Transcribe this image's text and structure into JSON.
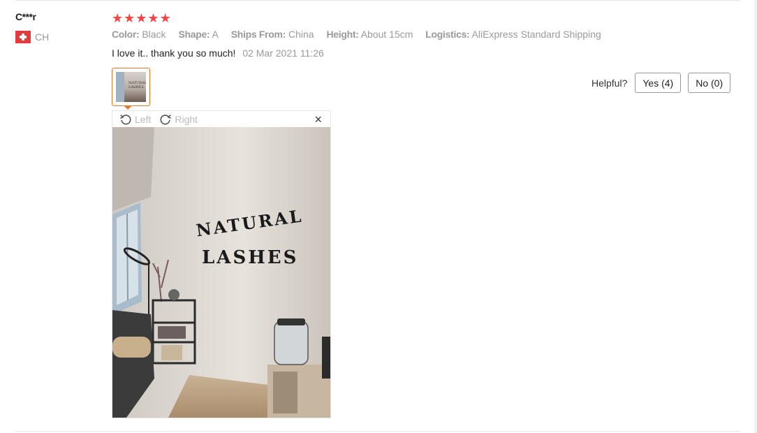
{
  "review": {
    "user": {
      "name": "C***r",
      "country": "CH"
    },
    "rating": 5,
    "attributes": [
      {
        "key": "Color:",
        "value": "Black"
      },
      {
        "key": "Shape:",
        "value": "A"
      },
      {
        "key": "Ships From:",
        "value": "China"
      },
      {
        "key": "Height:",
        "value": "About 15cm"
      },
      {
        "key": "Logistics:",
        "value": "AliExpress Standard Shipping"
      }
    ],
    "text": "I love it.. thank you so much!",
    "date": "02 Mar 2021 11:26",
    "photo_text": {
      "line1": "NATURAL",
      "line2": "LASHES"
    }
  },
  "viewer": {
    "rotate_left_label": "Left",
    "rotate_right_label": "Right",
    "close_glyph": "×"
  },
  "helpful": {
    "label": "Helpful?",
    "yes_label": "Yes (4)",
    "no_label": "No (0)"
  },
  "colors": {
    "star": "#f44545",
    "accent": "#e5772a",
    "muted": "#999999"
  },
  "icons": {
    "rotate_left": "rotate-left-icon",
    "rotate_right": "rotate-right-icon",
    "close": "close-icon",
    "flag": "swiss-flag-icon",
    "star": "star-icon"
  }
}
